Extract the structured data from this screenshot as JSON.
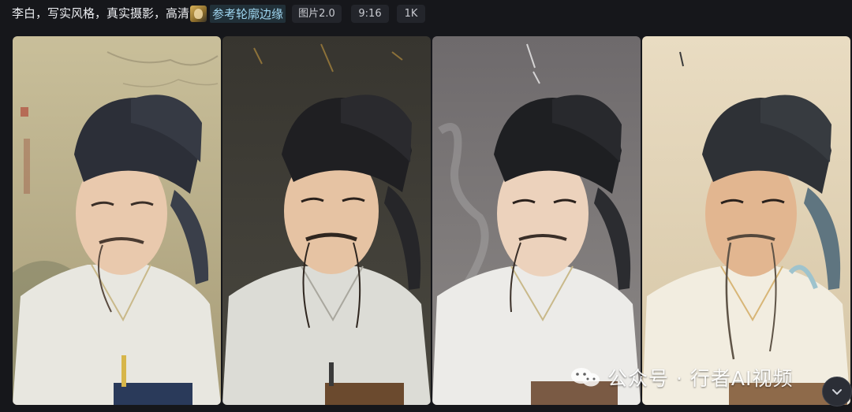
{
  "prompt": {
    "text": "李白，写实风格，真实摄影，高清",
    "reference_label": "参考轮廓边缘"
  },
  "tags": [
    {
      "label": "图片2.0"
    },
    {
      "label": "9:16"
    },
    {
      "label": "1K"
    }
  ],
  "results": [
    {
      "index": 1,
      "seal_text": ""
    },
    {
      "index": 2,
      "seal_text": ""
    },
    {
      "index": 3,
      "seal_text": ""
    },
    {
      "index": 4,
      "seal_text": ""
    }
  ],
  "watermark": {
    "text": "公众号 · 行者AI视频",
    "icon": "wechat-icon"
  },
  "scroll_button": {
    "icon": "chevron-down-icon"
  },
  "colors": {
    "background": "#16171b",
    "pill_bg": "#23252b",
    "reference_text": "#9fd6f0"
  }
}
